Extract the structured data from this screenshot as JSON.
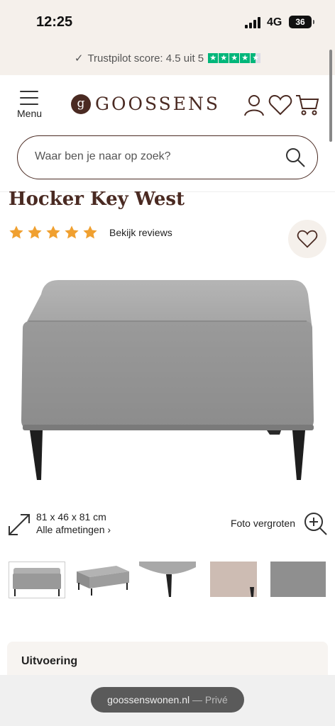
{
  "status_bar": {
    "time": "12:25",
    "network": "4G",
    "battery": "36"
  },
  "trustpilot": {
    "text": "Trustpilot score: 4.5 uit 5",
    "star_glyph": "★",
    "rating": 4.5,
    "color": "#00b67a"
  },
  "header": {
    "menu_label": "Menu",
    "logo_mark": "g",
    "logo_text": "GOOSSENS",
    "icons": [
      "user-icon",
      "heart-icon",
      "cart-icon"
    ],
    "brand_color": "#4a2a22"
  },
  "search": {
    "placeholder": "Waar ben je naar op zoek?"
  },
  "product": {
    "title": "Hocker Key West",
    "rating_stars": 5,
    "star_color": "#f0a030",
    "reviews_link": "Bekijk reviews",
    "dimensions": "81 x 46 x 81 cm",
    "all_dimensions": "Alle afmetingen ›",
    "zoom_label": "Foto vergroten",
    "thumbnail_count": 5,
    "active_thumbnail": 1
  },
  "variant": {
    "title": "Uitvoering"
  },
  "browser": {
    "url": "goossenswonen.nl",
    "private_label": "— Privé"
  }
}
